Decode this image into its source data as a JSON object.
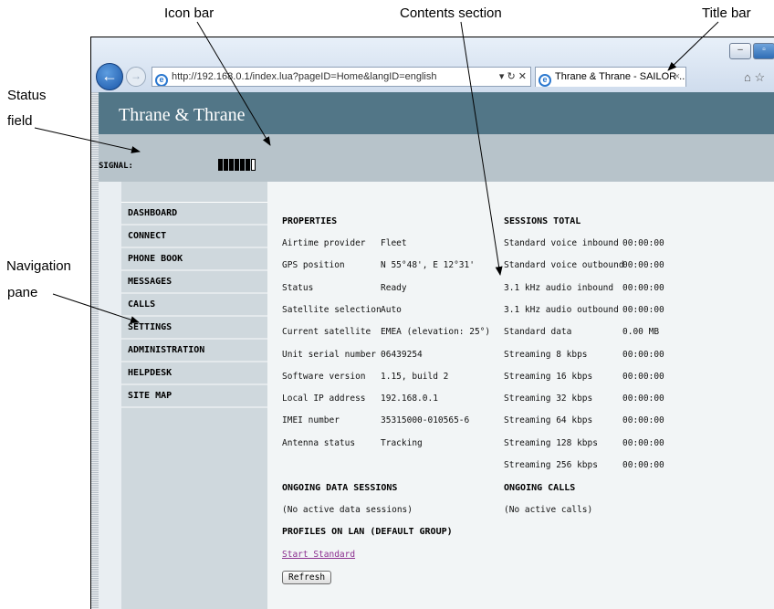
{
  "callouts": {
    "icon_bar": "Icon bar",
    "contents_section": "Contents section",
    "title_bar": "Title bar",
    "status": "Status",
    "field": "field",
    "navigation": "Navigation",
    "pane": "pane"
  },
  "browser": {
    "url": "http://192.168.0.1/index.lua?pageID=Home&langID=english",
    "tab_title": "Thrane & Thrane - SAILOR ...",
    "tab_close": "×",
    "addr_controls": "▾ ↻ ✕",
    "back_glyph": "←",
    "forward_glyph": "→",
    "home_glyph": "⌂",
    "fav_glyph": "☆"
  },
  "page": {
    "brand": "Thrane & Thrane",
    "signal_label": "SIGNAL:",
    "signal_level": {
      "filled": 6,
      "total": 7
    }
  },
  "nav": {
    "items": [
      "DASHBOARD",
      "CONNECT",
      "PHONE BOOK",
      "MESSAGES",
      "CALLS",
      "SETTINGS",
      "ADMINISTRATION",
      "HELPDESK",
      "SITE MAP"
    ]
  },
  "properties": {
    "title": "PROPERTIES",
    "rows": [
      {
        "label": "Airtime provider",
        "value": "Fleet"
      },
      {
        "label": "GPS position",
        "value": "N 55°48', E 12°31'"
      },
      {
        "label": "Status",
        "value": "Ready"
      },
      {
        "label": "Satellite selection",
        "value": "Auto"
      },
      {
        "label": "Current satellite",
        "value": "EMEA (elevation: 25°)"
      },
      {
        "label": "Unit serial number",
        "value": "06439254"
      },
      {
        "label": "Software version",
        "value": "1.15, build 2"
      },
      {
        "label": "Local IP address",
        "value": "192.168.0.1"
      },
      {
        "label": "IMEI number",
        "value": "35315000-010565-6"
      },
      {
        "label": "Antenna status",
        "value": "Tracking"
      }
    ]
  },
  "sessions": {
    "title": "SESSIONS TOTAL",
    "rows": [
      {
        "label": "Standard voice inbound",
        "value": "00:00:00"
      },
      {
        "label": "Standard voice outbound",
        "value": "00:00:00"
      },
      {
        "label": "3.1 kHz audio inbound",
        "value": "00:00:00"
      },
      {
        "label": "3.1 kHz audio outbound",
        "value": "00:00:00"
      },
      {
        "label": "Standard data",
        "value": "0.00 MB"
      },
      {
        "label": "Streaming 8 kbps",
        "value": "00:00:00"
      },
      {
        "label": "Streaming 16 kbps",
        "value": "00:00:00"
      },
      {
        "label": "Streaming 32 kbps",
        "value": "00:00:00"
      },
      {
        "label": "Streaming 64 kbps",
        "value": "00:00:00"
      },
      {
        "label": "Streaming 128 kbps",
        "value": "00:00:00"
      },
      {
        "label": "Streaming 256 kbps",
        "value": "00:00:00"
      }
    ]
  },
  "ongoing_data": {
    "title": "ONGOING DATA SESSIONS",
    "text": "(No active data sessions)"
  },
  "ongoing_calls": {
    "title": "ONGOING CALLS",
    "text": "(No active calls)"
  },
  "profiles": {
    "title": "PROFILES ON LAN (DEFAULT GROUP)",
    "link": "Start Standard",
    "refresh": "Refresh"
  }
}
